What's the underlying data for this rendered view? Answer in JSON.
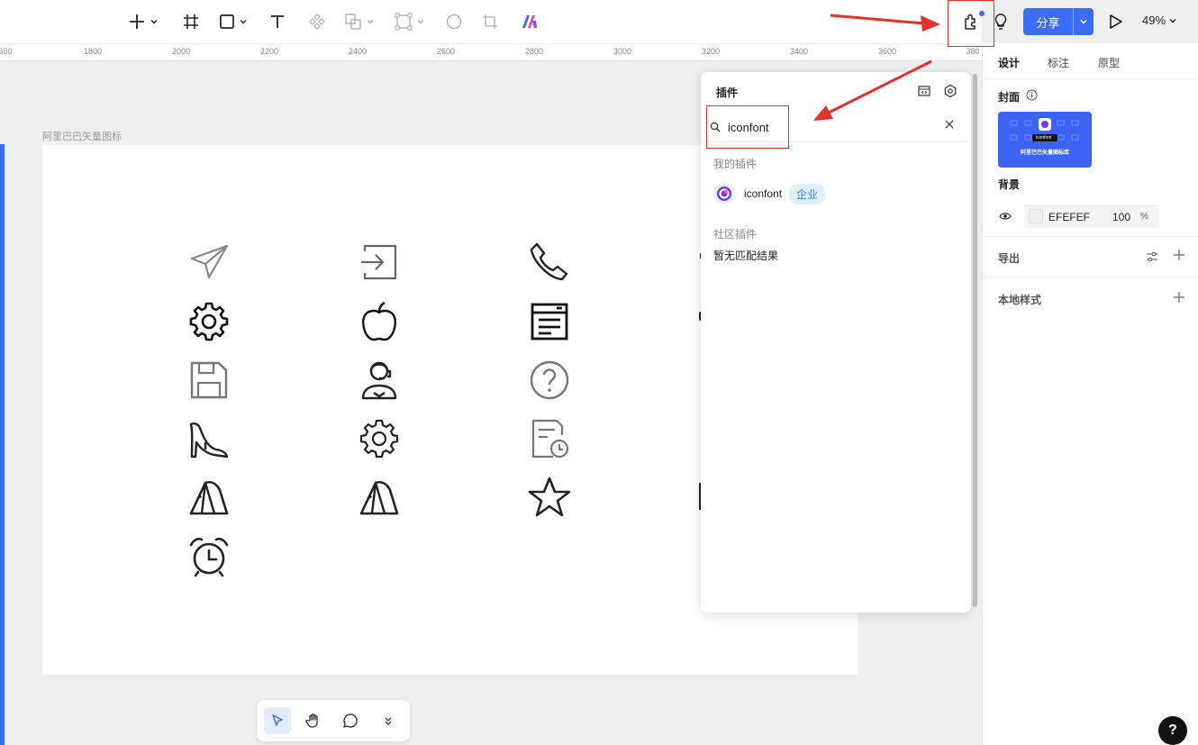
{
  "toolbar": {
    "tools": [
      "add-icon",
      "frame-icon",
      "rectangle-icon",
      "text-icon",
      "component-icon",
      "boolean-icon",
      "vector-icon",
      "circle-icon",
      "crop-icon",
      "ai-icon"
    ],
    "share_label": "分享",
    "zoom": "49%"
  },
  "ruler": {
    "labels": [
      "600",
      "1800",
      "2000",
      "2200",
      "2400",
      "2600",
      "2800",
      "3000",
      "3200",
      "3400",
      "3600",
      "380"
    ]
  },
  "canvas": {
    "frame_label": "阿里巴巴矢量图标",
    "icons": [
      "paper-plane-icon",
      "sign-in-icon",
      "phone-icon",
      "gear-icon",
      "apple-icon",
      "list-window-icon",
      "save-disk-icon",
      "customer-service-icon",
      "question-circle-icon",
      "high-heel-icon",
      "gear-outline-icon",
      "schedule-doc-icon",
      "tent-icon",
      "tent-icon-2",
      "star-icon",
      "alarm-clock-icon"
    ]
  },
  "plugin_panel": {
    "title": "插件",
    "search_value": "iconfont",
    "my_plugins_label": "我的插件",
    "plugin_name": "iconfont",
    "plugin_badge": "企业",
    "community_label": "社区插件",
    "no_result": "暂无匹配结果"
  },
  "right_panel": {
    "tabs": [
      "设计",
      "标注",
      "原型"
    ],
    "cover_label": "封面",
    "cover_preview": {
      "badge": "iconfont",
      "title": "阿里巴巴矢量图标库"
    },
    "background_label": "背景",
    "bg_hex": "EFEFEF",
    "bg_opacity": "100",
    "bg_pct": "%",
    "export_label": "导出",
    "local_styles_label": "本地样式"
  },
  "help": "?",
  "colors": {
    "accent": "#3a6cf5",
    "annotation": "#e5302b"
  }
}
